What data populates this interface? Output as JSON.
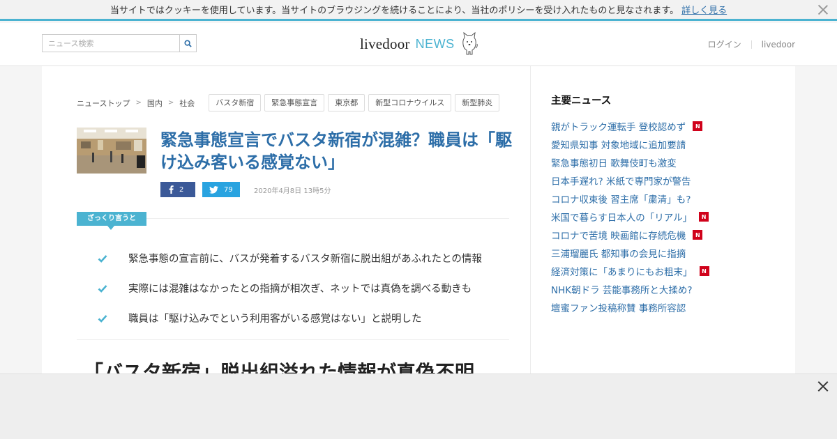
{
  "cookie_bar": {
    "message": "当サイトではクッキーを使用しています。当サイトのブラウジングを続けることにより、当社のポリシーを受け入れたものと見なされます。",
    "more_link": "詳しく見る"
  },
  "header": {
    "search_placeholder": "ニュース検索",
    "logo_text": "livedoor",
    "logo_news": "NEWS",
    "login_link": "ログイン",
    "livedoor_link": "livedoor"
  },
  "breadcrumb": [
    "ニューストップ",
    "国内",
    "社会"
  ],
  "tags": [
    "バスタ新宿",
    "緊急事態宣言",
    "東京都",
    "新型コロナウイルス",
    "新型肺炎"
  ],
  "article": {
    "headline": "緊急事態宣言でバスタ新宿が混雑？職員は「駆け込み客いる感覚ない」",
    "facebook_count": "2",
    "twitter_count": "79",
    "date": "2020年4月8日 13時5分",
    "summary_label": "ざっくり言うと",
    "summary": [
      "緊急事態の宣言前に、バスが発着するバスタ新宿に脱出組があふれたとの情報",
      "実際には混雑はなかったとの指摘が相次ぎ、ネットでは真偽を調べる動きも",
      "職員は「駆け込みでという利用客がいる感覚はない」と説明した"
    ],
    "subheading": "「バスタ新宿」脱出組溢れた情報が真偽不明"
  },
  "sidebar": {
    "title": "主要ニュース",
    "items": [
      {
        "text": "親がトラック運転手 登校認めず",
        "new": true
      },
      {
        "text": "愛知県知事 対象地域に追加要請",
        "new": false
      },
      {
        "text": "緊急事態初日 歌舞伎町も激変",
        "new": false
      },
      {
        "text": "日本手遅れ? 米紙で専門家が警告",
        "new": false
      },
      {
        "text": "コロナ収束後 習主席「粛清」も?",
        "new": false
      },
      {
        "text": "米国で暮らす日本人の「リアル」",
        "new": true
      },
      {
        "text": "コロナで苦境 映画館に存続危機",
        "new": true
      },
      {
        "text": "三浦瑠麗氏 都知事の会見に指摘",
        "new": false
      },
      {
        "text": "経済対策に「あまりにもお粗末」",
        "new": true
      },
      {
        "text": "NHK朝ドラ 芸能事務所と大揉め?",
        "new": false
      },
      {
        "text": "壇蜜ファン投稿称賛 事務所容認",
        "new": false
      }
    ],
    "new_badge": "N"
  },
  "colors": {
    "accent": "#4bb3d1",
    "link": "#2d6ea8",
    "facebook": "#3b5998",
    "twitter": "#29a3e0",
    "new_badge": "#d0021b"
  },
  "icons": {
    "search": "search-icon",
    "close": "close-icon",
    "facebook": "facebook-icon",
    "twitter": "twitter-icon",
    "check": "check-icon",
    "mascot": "dog-mascot-icon"
  }
}
